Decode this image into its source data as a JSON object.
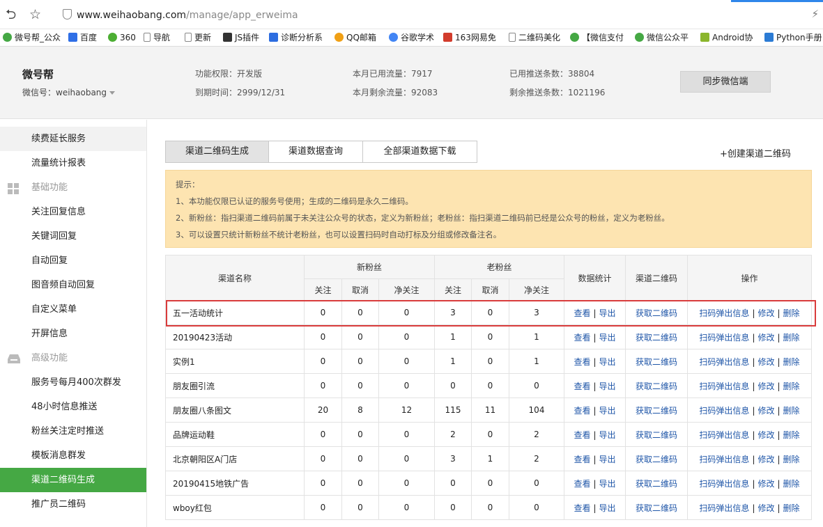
{
  "browser": {
    "url_host": "www.weihaobang.com",
    "url_path": "/manage/app_erweima"
  },
  "bookmarks": [
    {
      "label": "微号帮_公众",
      "icon": "wechat-icon",
      "color": "#45a844"
    },
    {
      "label": "百度",
      "icon": "baidu-paw-icon",
      "color": "#2f6fe6"
    },
    {
      "label": "360",
      "icon": "360-browser-icon",
      "color": "#4cae33"
    },
    {
      "label": "导航",
      "icon": "page-icon",
      "color": "#888888"
    },
    {
      "label": "更新",
      "icon": "page-icon",
      "color": "#888888"
    },
    {
      "label": "JS插件",
      "icon": "js-icon",
      "color": "#333333"
    },
    {
      "label": "诊断分析系",
      "icon": "analysis-icon",
      "color": "#2d6de0"
    },
    {
      "label": "QQ邮箱",
      "icon": "qq-mail-icon",
      "color": "#f0a015"
    },
    {
      "label": "谷歌学术",
      "icon": "google-icon",
      "color": "#4285f4"
    },
    {
      "label": "163网易免",
      "icon": "163-mail-icon",
      "color": "#d23c2c"
    },
    {
      "label": "二维码美化",
      "icon": "page-icon",
      "color": "#888888"
    },
    {
      "label": "【微信支付",
      "icon": "wechat-icon",
      "color": "#45a844"
    },
    {
      "label": "微信公众平",
      "icon": "wechat-icon",
      "color": "#45a844"
    },
    {
      "label": "Android协",
      "icon": "android-icon",
      "color": "#8bb62d"
    },
    {
      "label": "Python手册",
      "icon": "python-icon",
      "color": "#2b7bd4"
    }
  ],
  "header": {
    "brand": "微号帮",
    "account": "微信号：weihaobang",
    "stats": {
      "permission": "功能权限：开发版",
      "expire": "到期时间：2999/12/31",
      "used_traffic": "本月已用流量：7917",
      "remain_traffic": "本月剩余流量：92083",
      "used_push": "已用推送条数：38804",
      "remain_push": "剩余推送条数：1021196"
    },
    "sync_button": "同步微信端"
  },
  "sidebar": {
    "items": [
      {
        "label": "续费延长服务"
      },
      {
        "label": "流量统计报表"
      },
      {
        "label": "基础功能",
        "heading": true,
        "icon": "grid-icon"
      },
      {
        "label": "关注回复信息"
      },
      {
        "label": "关键词回复"
      },
      {
        "label": "自动回复"
      },
      {
        "label": "图音频自动回复"
      },
      {
        "label": "自定义菜单"
      },
      {
        "label": "开屏信息"
      },
      {
        "label": "高级功能",
        "heading": true,
        "icon": "inbox-icon"
      },
      {
        "label": "服务号每月400次群发"
      },
      {
        "label": "48小时信息推送"
      },
      {
        "label": "粉丝关注定时推送"
      },
      {
        "label": "模板消息群发"
      },
      {
        "label": "渠道二维码生成",
        "active": true
      },
      {
        "label": "推广员二维码"
      }
    ]
  },
  "tabs": [
    {
      "label": "渠道二维码生成",
      "active": true
    },
    {
      "label": "渠道数据查询"
    },
    {
      "label": "全部渠道数据下载"
    }
  ],
  "create_link": "+创建渠道二维码",
  "tips": [
    "提示：",
    "1、本功能仅限已认证的服务号使用；生成的二维码是永久二维码。",
    "2、新粉丝：指扫渠道二维码前属于未关注公众号的状态，定义为新粉丝；老粉丝：指扫渠道二维码前已经是公众号的粉丝，定义为老粉丝。",
    "3、可以设置只统计新粉丝不统计老粉丝，也可以设置扫码时自动打标及分组或修改备注名。"
  ],
  "table": {
    "headers": {
      "name": "渠道名称",
      "new_fans": "新粉丝",
      "old_fans": "老粉丝",
      "stats": "数据统计",
      "qrcode": "渠道二维码",
      "ops": "操作",
      "follow": "关注",
      "cancel": "取消",
      "net": "净关注"
    },
    "links": {
      "view": "查看",
      "export": "导出",
      "get_qr": "获取二维码",
      "popup": "扫码弹出信息",
      "edit": "修改",
      "delete": "删除",
      "sep": "|"
    },
    "rows": [
      {
        "name": "五一活动统计",
        "nf": "0",
        "nc": "0",
        "nn": "0",
        "of": "3",
        "oc": "0",
        "on": "3"
      },
      {
        "name": "20190423活动",
        "nf": "0",
        "nc": "0",
        "nn": "0",
        "of": "1",
        "oc": "0",
        "on": "1"
      },
      {
        "name": "实例1",
        "nf": "0",
        "nc": "0",
        "nn": "0",
        "of": "1",
        "oc": "0",
        "on": "1"
      },
      {
        "name": "朋友圈引流",
        "nf": "0",
        "nc": "0",
        "nn": "0",
        "of": "0",
        "oc": "0",
        "on": "0"
      },
      {
        "name": "朋友圈八条图文",
        "nf": "20",
        "nc": "8",
        "nn": "12",
        "of": "115",
        "oc": "11",
        "on": "104"
      },
      {
        "name": "品牌运动鞋",
        "nf": "0",
        "nc": "0",
        "nn": "0",
        "of": "2",
        "oc": "0",
        "on": "2"
      },
      {
        "name": "北京朝阳区A门店",
        "nf": "0",
        "nc": "0",
        "nn": "0",
        "of": "3",
        "oc": "1",
        "on": "2"
      },
      {
        "name": "20190415地铁广告",
        "nf": "0",
        "nc": "0",
        "nn": "0",
        "of": "0",
        "oc": "0",
        "on": "0"
      },
      {
        "name": "wboy红包",
        "nf": "0",
        "nc": "0",
        "nn": "0",
        "of": "0",
        "oc": "0",
        "on": "0"
      }
    ]
  },
  "highlight_color": "#d93b3b"
}
